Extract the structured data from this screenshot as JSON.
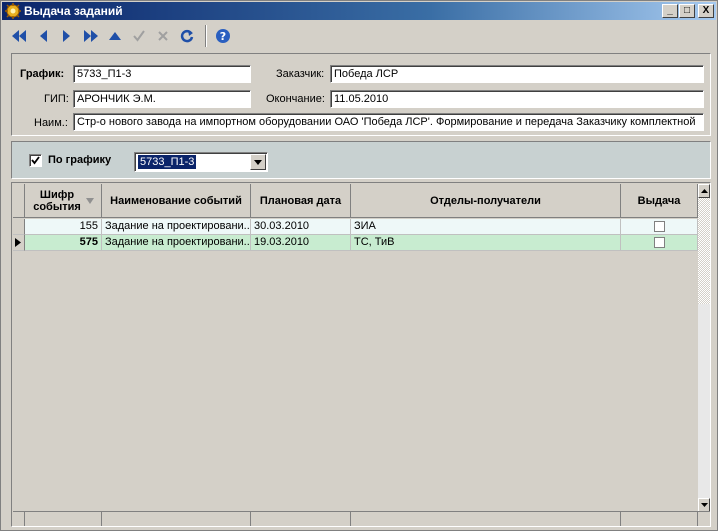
{
  "window": {
    "title": "Выдача заданий",
    "controls": [
      "_",
      "□",
      "X"
    ]
  },
  "toolbar": {
    "buttons": [
      {
        "name": "first-record",
        "icon": "first-icon",
        "enabled": true
      },
      {
        "name": "prior-record",
        "icon": "prior-icon",
        "enabled": true
      },
      {
        "name": "next-record",
        "icon": "next-icon",
        "enabled": true
      },
      {
        "name": "last-record",
        "icon": "last-icon",
        "enabled": true
      },
      {
        "name": "edit-record",
        "icon": "up-triangle-icon",
        "enabled": true
      },
      {
        "name": "post-record",
        "icon": "check-icon",
        "enabled": false
      },
      {
        "name": "cancel-record",
        "icon": "cross-icon",
        "enabled": false
      },
      {
        "name": "refresh",
        "icon": "refresh-icon",
        "enabled": true
      },
      {
        "name": "help",
        "icon": "help-icon",
        "enabled": true
      }
    ]
  },
  "header": {
    "schedule_label": "График:",
    "schedule_value": "5733_П1-3",
    "customer_label": "Заказчик:",
    "customer_value": "Победа ЛСР",
    "gip_label": "ГИП:",
    "gip_value": "АРОНЧИК Э.М.",
    "end_label": "Окончание:",
    "end_value": "11.05.2010",
    "name_label": "Наим.:",
    "name_value": "Стр-о нового завода на импортном оборудовании ОАО 'Победа ЛСР'. Формирование и передача Заказчику комплектной"
  },
  "filter": {
    "checkbox_label": "По графику",
    "checked": true,
    "combo_value": "5733_П1-3"
  },
  "grid": {
    "columns": [
      {
        "title": "Шифр события"
      },
      {
        "title": "Наименование событий"
      },
      {
        "title": "Плановая дата"
      },
      {
        "title": "Отделы-получатели"
      },
      {
        "title": "Выдача"
      }
    ],
    "rows": [
      {
        "code": "155",
        "name": "Задание на проектировани...",
        "date": "30.03.2010",
        "depts": "ЗИА",
        "issued": false,
        "current": false
      },
      {
        "code": "575",
        "name": "Задание на проектировани...",
        "date": "19.03.2010",
        "depts": "ТС, ТиВ",
        "issued": false,
        "current": true
      }
    ],
    "colors": {
      "row_even": "#eef8f8",
      "row_selected": "#c8ecd0"
    }
  }
}
